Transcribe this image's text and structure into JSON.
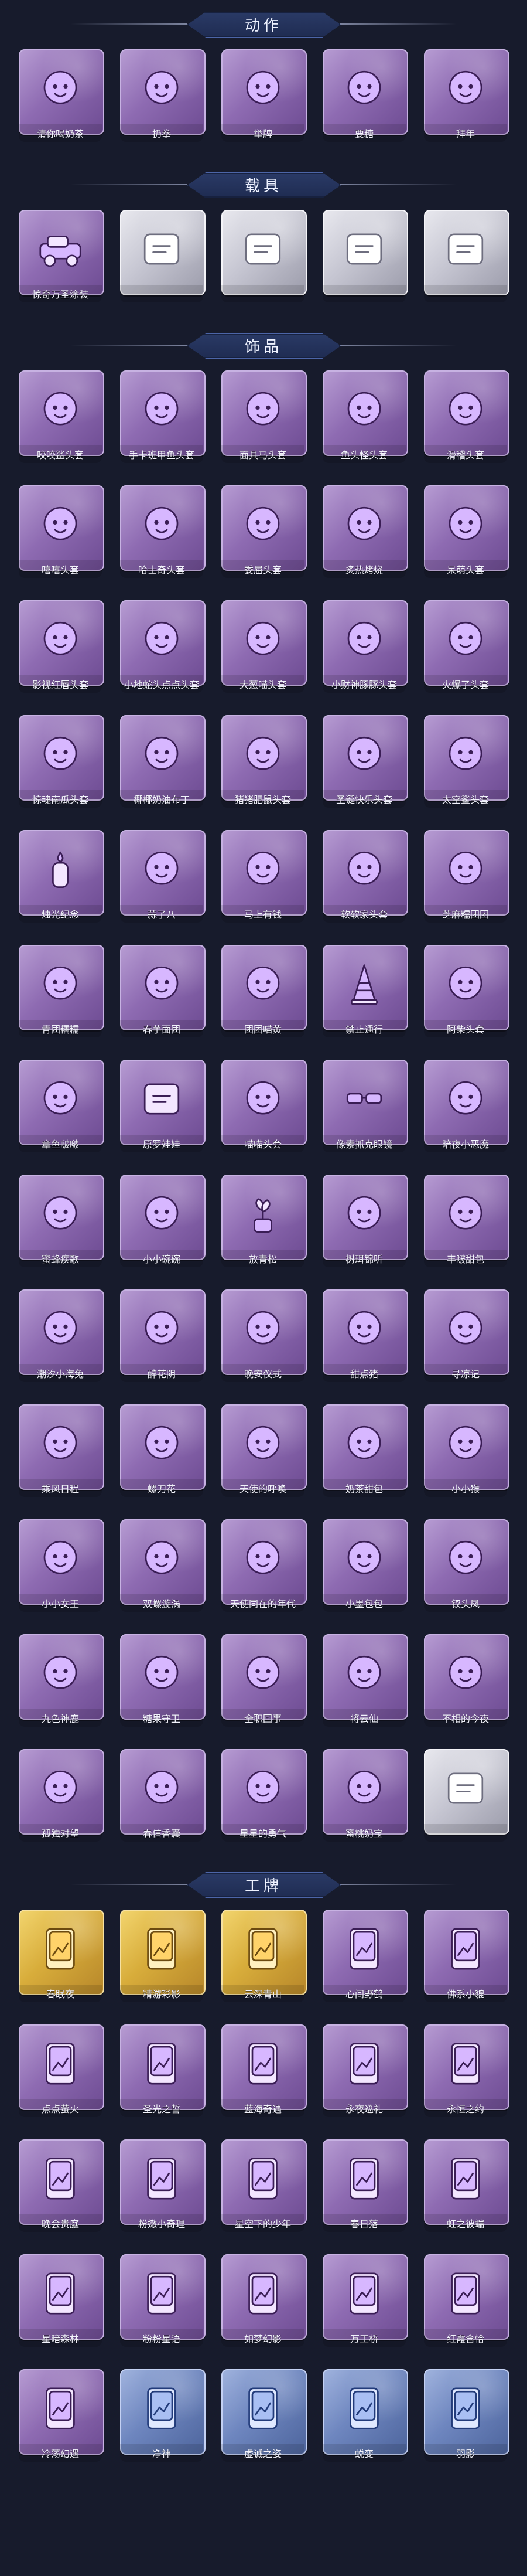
{
  "sections": [
    {
      "title": "动作",
      "tile_style": "purple",
      "items": [
        {
          "label": "请你喝奶茶",
          "icon": "figure-icon"
        },
        {
          "label": "扔拳",
          "icon": "figure-icon"
        },
        {
          "label": "举牌",
          "icon": "figure-icon"
        },
        {
          "label": "要糖",
          "icon": "figure-icon"
        },
        {
          "label": "拜年",
          "icon": "figure-icon"
        }
      ]
    },
    {
      "title": "载具",
      "tile_style": "purple",
      "items": [
        {
          "label": "惊奇万圣涂装",
          "icon": "vehicle-icon"
        },
        {
          "label": "",
          "icon": "locked-placeholder-icon",
          "tile_style": "silver"
        },
        {
          "label": "",
          "icon": "locked-placeholder-icon",
          "tile_style": "silver"
        },
        {
          "label": "",
          "icon": "locked-placeholder-icon",
          "tile_style": "silver"
        },
        {
          "label": "",
          "icon": "locked-placeholder-icon",
          "tile_style": "silver"
        }
      ]
    },
    {
      "title": "饰品",
      "tile_style": "purple",
      "items": [
        {
          "label": "咬咬鲨头套",
          "icon": "shark-head-icon"
        },
        {
          "label": "手卡班甲鱼头套",
          "icon": "fish-head-icon"
        },
        {
          "label": "面具马头套",
          "icon": "horse-head-icon"
        },
        {
          "label": "鱼头怪头套",
          "icon": "fish-head-icon"
        },
        {
          "label": "滑稽头套",
          "icon": "emoji-head-icon"
        },
        {
          "label": "嘻嘻头套",
          "icon": "emoji-head-icon"
        },
        {
          "label": "哈士奇头套",
          "icon": "dog-head-icon"
        },
        {
          "label": "委屈头套",
          "icon": "emoji-head-icon"
        },
        {
          "label": "炙热烤烧",
          "icon": "toast-icon"
        },
        {
          "label": "呆萌头套",
          "icon": "emoji-head-icon"
        },
        {
          "label": "影视红唇头套",
          "icon": "mascot-head-icon"
        },
        {
          "label": "小地蛇头点点头套",
          "icon": "mascot-head-icon"
        },
        {
          "label": "大葱喵头套",
          "icon": "veggie-head-icon"
        },
        {
          "label": "小财神豚豚头套",
          "icon": "pig-head-icon"
        },
        {
          "label": "火爆了头套",
          "icon": "fire-head-icon"
        },
        {
          "label": "惊魂南瓜头套",
          "icon": "pumpkin-head-icon"
        },
        {
          "label": "椰椰奶油布丁",
          "icon": "pudding-icon"
        },
        {
          "label": "猪猪肥鼠头套",
          "icon": "pig-head-icon"
        },
        {
          "label": "圣诞快乐头套",
          "icon": "snowman-head-icon"
        },
        {
          "label": "太空鲨头套",
          "icon": "shark-head-icon"
        },
        {
          "label": "烛光纪念",
          "icon": "candle-icon"
        },
        {
          "label": "蒜了八",
          "icon": "garlic-icon"
        },
        {
          "label": "马上有钱",
          "icon": "horse-head-icon"
        },
        {
          "label": "软软家头套",
          "icon": "cloud-head-icon"
        },
        {
          "label": "芝麻糯团团",
          "icon": "dumpling-head-icon"
        },
        {
          "label": "青团糯糯",
          "icon": "rice-ball-icon"
        },
        {
          "label": "春芋面团",
          "icon": "bread-icon"
        },
        {
          "label": "团团喵黄",
          "icon": "cat-head-icon"
        },
        {
          "label": "禁止通行",
          "icon": "traffic-cone-icon"
        },
        {
          "label": "阿柴头套",
          "icon": "dog-head-icon"
        },
        {
          "label": "章鱼啵啵",
          "icon": "octopus-icon"
        },
        {
          "label": "原罗娃娃",
          "icon": "locked-placeholder-icon"
        },
        {
          "label": "喵喵头套",
          "icon": "cat-head-icon"
        },
        {
          "label": "像素抓克眼镜",
          "icon": "sunglasses-icon"
        },
        {
          "label": "暗夜小恶魔",
          "icon": "devil-head-icon"
        },
        {
          "label": "蜜蜂疾歌",
          "icon": "bee-head-icon"
        },
        {
          "label": "小小碗碗",
          "icon": "bowl-head-icon"
        },
        {
          "label": "放青松",
          "icon": "plant-icon"
        },
        {
          "label": "树珥锦听",
          "icon": "flower-icon"
        },
        {
          "label": "丰啵甜包",
          "icon": "cake-icon"
        },
        {
          "label": "潮汐小海兔",
          "icon": "bunny-head-icon"
        },
        {
          "label": "醉花阴",
          "icon": "charm-icon"
        },
        {
          "label": "晚安仪式",
          "icon": "figure-icon"
        },
        {
          "label": "甜点猪",
          "icon": "pig-head-icon"
        },
        {
          "label": "寻凉记",
          "icon": "hat-head-icon"
        },
        {
          "label": "乘风日程",
          "icon": "figure-icon"
        },
        {
          "label": "螺刀花",
          "icon": "charm-icon"
        },
        {
          "label": "天使的呼唤",
          "icon": "angel-icon"
        },
        {
          "label": "奶茶甜包",
          "icon": "qr-charm-icon"
        },
        {
          "label": "小小猴",
          "icon": "monkey-icon"
        },
        {
          "label": "小小女王",
          "icon": "queen-icon"
        },
        {
          "label": "双螺漩涡",
          "icon": "swirl-icon"
        },
        {
          "label": "天使同在的年代",
          "icon": "angel-icon"
        },
        {
          "label": "小墨包包",
          "icon": "fish-charm-icon"
        },
        {
          "label": "钗头凤",
          "icon": "queen-icon"
        },
        {
          "label": "九色神鹿",
          "icon": "deer-icon"
        },
        {
          "label": "糖果守卫",
          "icon": "charm-icon"
        },
        {
          "label": "全职回事",
          "icon": "figure-icon"
        },
        {
          "label": "将云仙",
          "icon": "charm-icon"
        },
        {
          "label": "不相的今夜",
          "icon": "charm-icon"
        },
        {
          "label": "孤独对望",
          "icon": "charm-icon"
        },
        {
          "label": "春信香囊",
          "icon": "charm-icon"
        },
        {
          "label": "星星的勇气",
          "icon": "charm-icon"
        },
        {
          "label": "蜜桃奶宝",
          "icon": "charm-icon"
        },
        {
          "label": "",
          "icon": "locked-placeholder-icon",
          "tile_style": "silver"
        }
      ]
    },
    {
      "title": "工牌",
      "tile_style": "gold",
      "items": [
        {
          "label": "春眠夜",
          "icon": "card-icon",
          "tile_style": "gold"
        },
        {
          "label": "精游彩影",
          "icon": "card-icon",
          "tile_style": "gold"
        },
        {
          "label": "云深青山",
          "icon": "card-icon",
          "tile_style": "gold"
        },
        {
          "label": "心间野鹤",
          "icon": "card-icon",
          "tile_style": "purple"
        },
        {
          "label": "佛系小貔",
          "icon": "card-icon",
          "tile_style": "purple"
        },
        {
          "label": "点点萤火",
          "icon": "card-icon",
          "tile_style": "purple"
        },
        {
          "label": "圣光之誓",
          "icon": "card-icon",
          "tile_style": "purple"
        },
        {
          "label": "蓝海奇遇",
          "icon": "card-icon",
          "tile_style": "purple"
        },
        {
          "label": "永夜巡礼",
          "icon": "card-icon",
          "tile_style": "purple"
        },
        {
          "label": "永恒之约",
          "icon": "card-icon",
          "tile_style": "purple"
        },
        {
          "label": "晚会贵庭",
          "icon": "card-icon",
          "tile_style": "purple"
        },
        {
          "label": "粉嫩小奇理",
          "icon": "card-icon",
          "tile_style": "purple"
        },
        {
          "label": "星空下的少年",
          "icon": "card-icon",
          "tile_style": "purple"
        },
        {
          "label": "春日落",
          "icon": "card-icon",
          "tile_style": "purple"
        },
        {
          "label": "虹之彼端",
          "icon": "card-icon",
          "tile_style": "purple"
        },
        {
          "label": "星暗森林",
          "icon": "card-icon",
          "tile_style": "purple"
        },
        {
          "label": "粉粉星语",
          "icon": "card-icon",
          "tile_style": "purple"
        },
        {
          "label": "如梦幻影",
          "icon": "card-icon",
          "tile_style": "purple"
        },
        {
          "label": "万工桥",
          "icon": "card-icon",
          "tile_style": "purple"
        },
        {
          "label": "红霞含恰",
          "icon": "card-icon",
          "tile_style": "purple"
        },
        {
          "label": "冷荡幻遇",
          "icon": "card-icon",
          "tile_style": "purple"
        },
        {
          "label": "净神",
          "icon": "card-icon",
          "tile_style": "blue"
        },
        {
          "label": "虚诚之姿",
          "icon": "card-icon",
          "tile_style": "blue"
        },
        {
          "label": "蜕变",
          "icon": "card-icon",
          "tile_style": "blue"
        },
        {
          "label": "羽影",
          "icon": "card-icon",
          "tile_style": "blue"
        }
      ]
    }
  ]
}
